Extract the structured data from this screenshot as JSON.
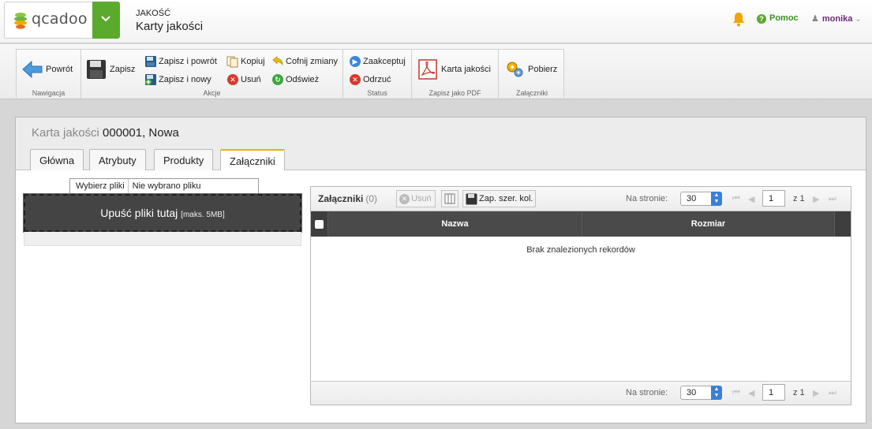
{
  "header": {
    "logo_text": "qcadoo",
    "breadcrumb_category": "JAKOŚĆ",
    "page_title": "Karty jakości",
    "help_label": "Pomoc",
    "user_name": "monika",
    "brand_color": "#5aaa2d"
  },
  "ribbon": {
    "groups": {
      "navigation": "Nawigacja",
      "actions": "Akcje",
      "status": "Status",
      "pdf": "Zapisz jako PDF",
      "attachments": "Załączniki"
    },
    "buttons": {
      "back": "Powrót",
      "save": "Zapisz",
      "save_back": "Zapisz i powrót",
      "save_new": "Zapisz i nowy",
      "copy": "Kopiuj",
      "delete": "Usuń",
      "undo": "Cofnij zmiany",
      "refresh": "Odśwież",
      "accept": "Zaakceptuj",
      "reject": "Odrzuć",
      "pdf_card": "Karta jakości",
      "download": "Pobierz"
    }
  },
  "form": {
    "title_label": "Karta jakości",
    "title_value": "000001, Nowa",
    "tabs": [
      "Główna",
      "Atrybuty",
      "Produkty",
      "Załączniki"
    ],
    "active_tab": "Załączniki"
  },
  "upload": {
    "choose_button": "Wybierz pliki",
    "no_file": "Nie wybrano pliku",
    "drop_text": "Upuść pliki tutaj",
    "max_size": "[maks. 5MB]"
  },
  "grid": {
    "title": "Załączniki",
    "count": "(0)",
    "delete_label": "Usuń",
    "save_widths_label": "Zap. szer. kol.",
    "per_page_label": "Na stronie:",
    "per_page_value": "30",
    "page_value": "1",
    "page_of": "z 1",
    "columns": [
      "Nazwa",
      "Rozmiar"
    ],
    "empty_text": "Brak znalezionych rekordów"
  }
}
